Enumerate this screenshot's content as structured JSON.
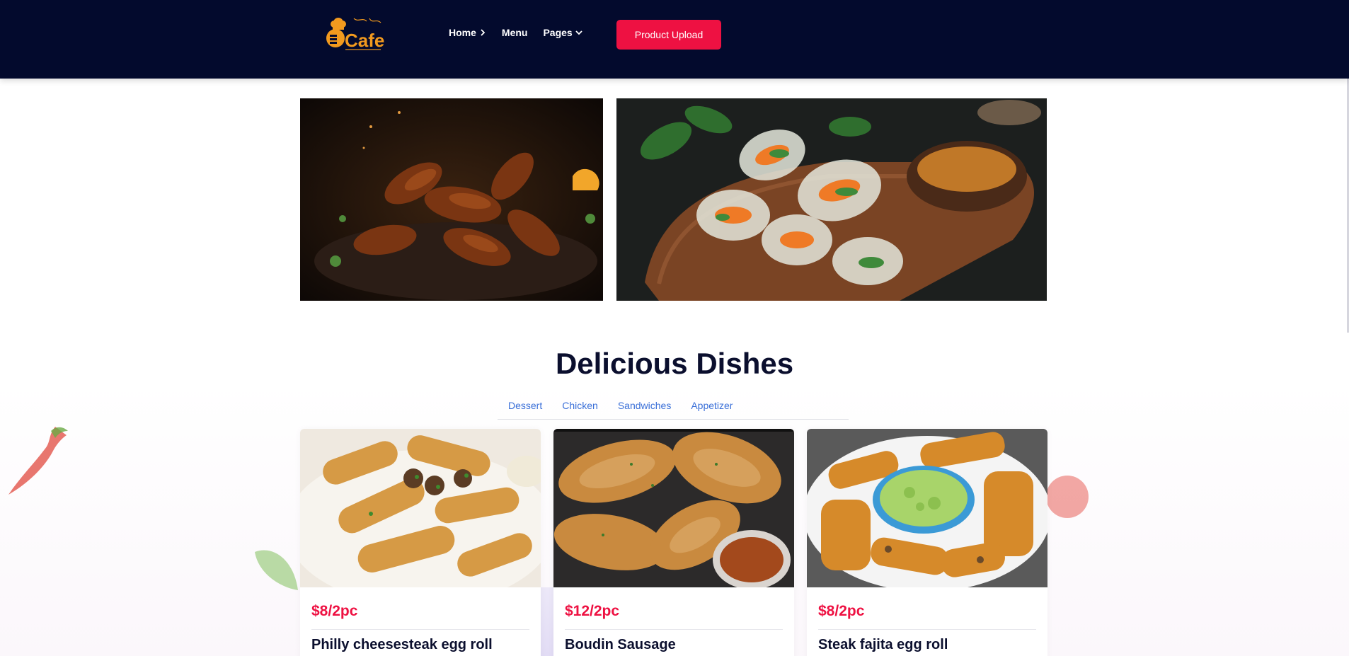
{
  "header": {
    "logo_text": "Cafe",
    "nav": [
      {
        "label": "Home",
        "icon": "chevron-right-icon"
      },
      {
        "label": "Menu",
        "icon": ""
      },
      {
        "label": "Pages",
        "icon": "chevron-down-icon"
      }
    ],
    "upload_button": "Product Upload"
  },
  "section": {
    "title": "Delicious Dishes",
    "tabs": [
      "Dessert",
      "Chicken",
      "Sandwiches",
      "Appetizer"
    ]
  },
  "dishes": [
    {
      "price": "$8/2pc",
      "name": "Philly cheesesteak egg roll"
    },
    {
      "price": "$12/2pc",
      "name": "Boudin Sausage"
    },
    {
      "price": "$8/2pc",
      "name": "Steak fajita egg roll"
    }
  ],
  "colors": {
    "header_bg": "#030a2d",
    "accent": "#ee1142",
    "tab_link": "#3a6fd8",
    "title": "#0b0f2e"
  }
}
